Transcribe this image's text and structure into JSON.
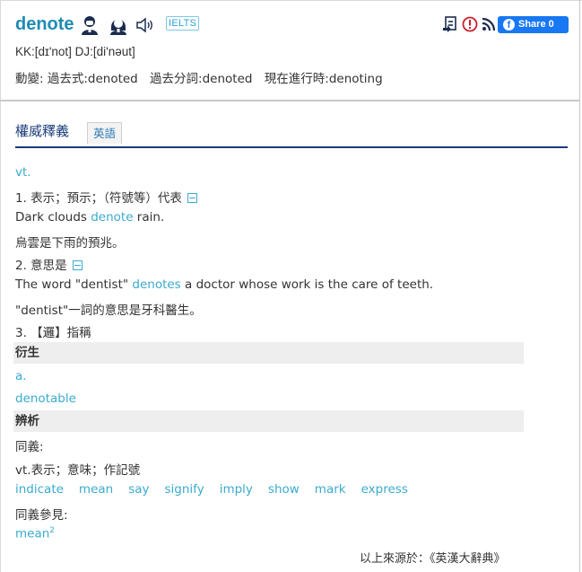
{
  "entry": {
    "word": "denote",
    "exam_tag": "IELTS",
    "pronunciation": "KK:[dɪ'not]  DJ:[di'nəut]",
    "conjugation": [
      "動變: 過去式:denoted",
      "過去分詞:denoted",
      "現在進行時:denoting"
    ]
  },
  "toolbar": {
    "share_label": "Share 0",
    "icons": [
      "save-word-icon",
      "report-icon",
      "rss-icon"
    ]
  },
  "tabs": [
    "權威釋義",
    "英語"
  ],
  "senses": [
    {
      "pos": "vt."
    },
    {
      "def": "1. 表示；預示；（符號等）代表"
    },
    {
      "example_pre": "Dark clouds ",
      "example_kw": "denote",
      "example_post": " rain."
    },
    {
      "translation": "烏雲是下雨的預兆。"
    },
    {
      "def": "2. 意思是"
    },
    {
      "example_pre": "The word \"dentist\" ",
      "example_kw": "denotes",
      "example_post": " a doctor whose work is the care of teeth."
    },
    {
      "translation": "\"dentist\"一詞的意思是牙科醫生。"
    },
    {
      "def": "3. 【邏】指稱"
    }
  ],
  "derivatives": {
    "heading": "衍生",
    "pos": "a.",
    "word": "denotable"
  },
  "analysis": {
    "heading": "辨析",
    "synonym_label": "同義:",
    "synonym_def": "vt.表示；意味；作記號",
    "synonyms": [
      "indicate",
      "mean",
      "say",
      "signify",
      "imply",
      "show",
      "mark",
      "express"
    ],
    "see_also_label": "同義參見:",
    "see_also_word": "mean",
    "see_also_sup": "2"
  },
  "source": "以上來源於：《英漢大辭典》",
  "colors": {
    "word": "#1e8cb4",
    "link": "#3aabcf",
    "share": "#1877f2",
    "tab_underline": "#1a3a7a"
  }
}
